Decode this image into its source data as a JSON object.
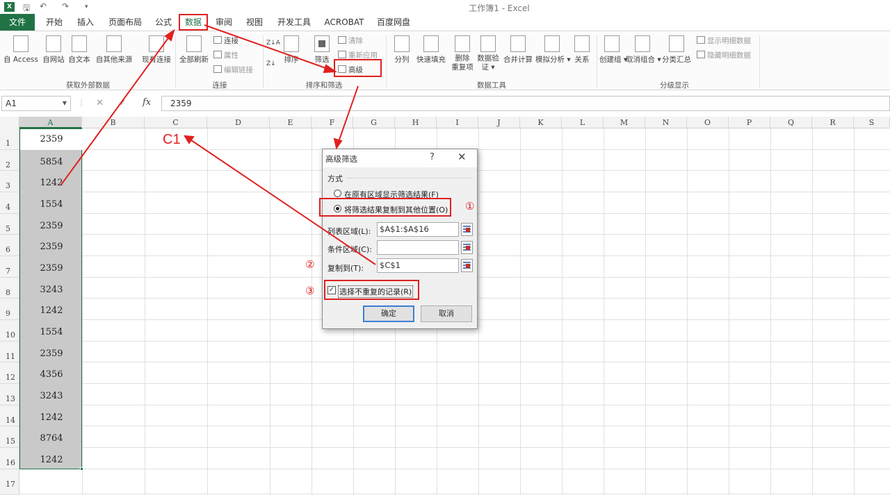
{
  "titlebar": {
    "title": "工作簿1 - Excel",
    "quick_access": [
      "save-icon",
      "undo-icon",
      "redo-icon",
      "customize-icon"
    ]
  },
  "tabs": [
    {
      "label": "文件"
    },
    {
      "label": "开始"
    },
    {
      "label": "插入"
    },
    {
      "label": "页面布局"
    },
    {
      "label": "公式"
    },
    {
      "label": "数据",
      "active": true
    },
    {
      "label": "审阅"
    },
    {
      "label": "视图"
    },
    {
      "label": "开发工具"
    },
    {
      "label": "ACROBAT"
    },
    {
      "label": "百度网盘"
    }
  ],
  "ribbon": {
    "external": {
      "buttons": [
        "自 Access",
        "自网站",
        "自文本",
        "自其他来源",
        "现有连接"
      ],
      "label": "获取外部数据"
    },
    "connections": {
      "refresh_all": "全部刷新",
      "items": [
        "连接",
        "属性",
        "编辑链接"
      ],
      "label": "连接"
    },
    "sort_filter": {
      "sort": "排序",
      "filter": "筛选",
      "items": [
        "清除",
        "重新应用",
        "高级"
      ],
      "label": "排序和筛选"
    },
    "data_tools": {
      "buttons": [
        "分列",
        "快速填充",
        "删除\n重复项",
        "数据验\n证 ▾",
        "合并计算",
        "模拟分析 ▾",
        "关系"
      ],
      "label": "数据工具"
    },
    "outline": {
      "buttons": [
        "创建组 ▾",
        "取消组合 ▾",
        "分类汇总"
      ],
      "items": [
        "显示明细数据",
        "隐藏明细数据"
      ],
      "label": "分级显示"
    }
  },
  "formula_bar": {
    "name_box": "A1",
    "fx": "fx",
    "value": "2359"
  },
  "grid": {
    "columns": [
      "A",
      "B",
      "C",
      "D",
      "E",
      "F",
      "G",
      "H",
      "I",
      "J",
      "K",
      "L",
      "M",
      "N",
      "O",
      "P",
      "Q",
      "R",
      "S"
    ],
    "rows": [
      "1",
      "2",
      "3",
      "4",
      "5",
      "6",
      "7",
      "8",
      "9",
      "10",
      "11",
      "12",
      "13",
      "14",
      "15",
      "16",
      "17"
    ],
    "column_a": [
      "2359",
      "5854",
      "1242",
      "1554",
      "2359",
      "2359",
      "2359",
      "3243",
      "1242",
      "1554",
      "2359",
      "4356",
      "3243",
      "1242",
      "8764",
      "1242"
    ]
  },
  "annotation": {
    "c1": "C1",
    "step1": "①",
    "step2": "②",
    "step3": "③",
    "color": "#e02020"
  },
  "dialog": {
    "title": "高级筛选",
    "help": "?",
    "close": "✕",
    "section": "方式",
    "option1": "在原有区域显示筛选结果(F)",
    "option2": "将筛选结果复制到其他位置(O)",
    "list_range_label": "列表区域(L):",
    "list_range_value": "$A$1:$A$16",
    "criteria_label": "条件区域(C):",
    "criteria_value": "",
    "copy_to_label": "复制到(T):",
    "copy_to_value": "$C$1",
    "unique_label": "选择不重复的记录(R)",
    "unique_checked": true,
    "ok": "确定",
    "cancel": "取消"
  }
}
